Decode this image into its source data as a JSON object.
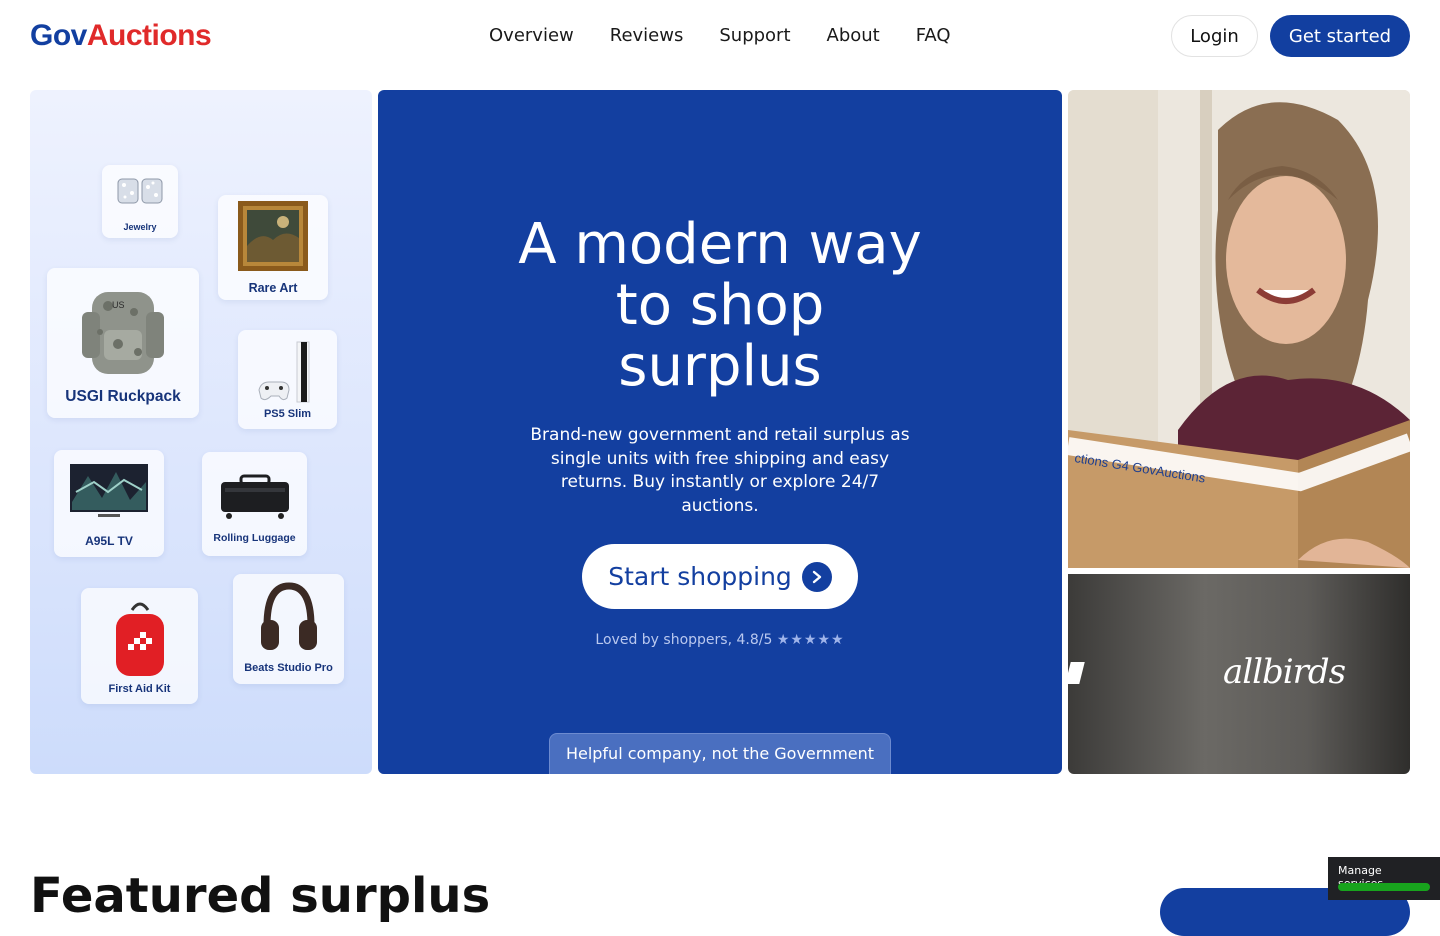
{
  "header": {
    "logo_part1": "Gov",
    "logo_part2": "Auctions",
    "nav": [
      "Overview",
      "Reviews",
      "Support",
      "About",
      "FAQ"
    ],
    "login_label": "Login",
    "get_started_label": "Get started"
  },
  "products": [
    {
      "name": "Jewelry"
    },
    {
      "name": "Rare Art"
    },
    {
      "name": "USGI Ruckpack"
    },
    {
      "name": "PS5 Slim"
    },
    {
      "name": "A95L TV"
    },
    {
      "name": "Rolling Luggage"
    },
    {
      "name": "First Aid Kit"
    },
    {
      "name": "Beats Studio Pro"
    }
  ],
  "hero": {
    "title_line1": "A modern way",
    "title_line2": "to shop",
    "title_line3": "surplus",
    "subtitle": "Brand-new government and retail surplus as single units with free shipping and easy returns. Buy instantly or explore 24/7 auctions.",
    "cta_label": "Start shopping",
    "rating_text": "Loved by shoppers, 4.8/5",
    "rating_stars": "★★★★★",
    "rating_value": 4.8,
    "disclaimer": "Helpful company, not the Government"
  },
  "photo": {
    "box_tape_text": "ctions G4 GovAuctions"
  },
  "brand_tile": {
    "brand": "allbirds"
  },
  "featured": {
    "heading": "Featured surplus"
  },
  "manage_services": {
    "label": "Manage services"
  },
  "colors": {
    "brand_blue": "#133fa0",
    "logo_red": "#e02a2a",
    "toggle_green": "#18a31d"
  }
}
